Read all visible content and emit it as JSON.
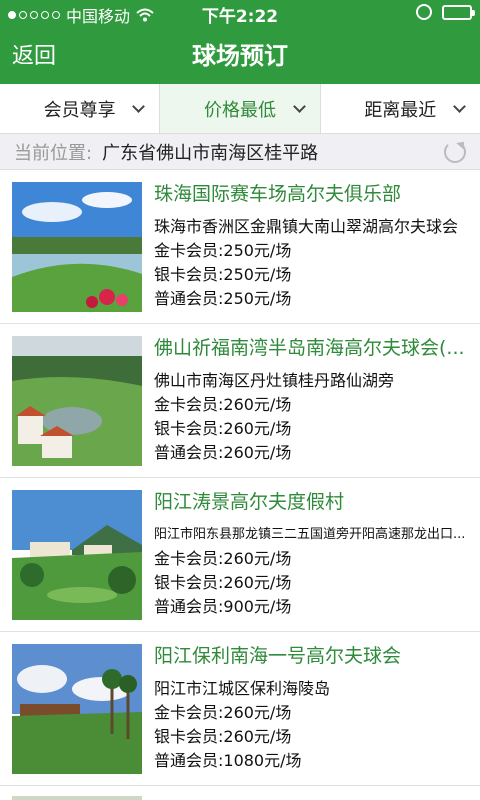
{
  "status_bar": {
    "carrier": "中国移动",
    "time": "下午2:22",
    "battery_level": 0.85
  },
  "nav": {
    "back_label": "返回",
    "title": "球场预订"
  },
  "filters": [
    {
      "label": "会员尊享",
      "active": false
    },
    {
      "label": "价格最低",
      "active": true
    },
    {
      "label": "距离最近",
      "active": false
    }
  ],
  "location": {
    "label": "当前位置:",
    "value": "广东省佛山市南海区桂平路"
  },
  "courses": [
    {
      "name": "珠海国际赛车场高尔夫俱乐部",
      "address": "珠海市香洲区金鼎镇大南山翠湖高尔夫球会",
      "gold": "金卡会员:250元/场",
      "silver": "银卡会员:250元/场",
      "normal": "普通会员:250元/场"
    },
    {
      "name": "佛山祈福南湾半岛南海高尔夫球会(...",
      "address": "佛山市南海区丹灶镇桂丹路仙湖旁",
      "gold": "金卡会员:260元/场",
      "silver": "银卡会员:260元/场",
      "normal": "普通会员:260元/场"
    },
    {
      "name": "阳江涛景高尔夫度假村",
      "address": "阳江市阳东县那龙镇三二五国道旁开阳高速那龙出口...",
      "gold": "金卡会员:260元/场",
      "silver": "银卡会员:260元/场",
      "normal": "普通会员:900元/场"
    },
    {
      "name": "阳江保利南海一号高尔夫球会",
      "address": "阳江市江城区保利海陵岛",
      "gold": "金卡会员:260元/场",
      "silver": "银卡会员:260元/场",
      "normal": "普通会员:1080元/场"
    }
  ],
  "colors": {
    "header": "#2f9a3e",
    "accent_text": "#2f8a3a"
  }
}
